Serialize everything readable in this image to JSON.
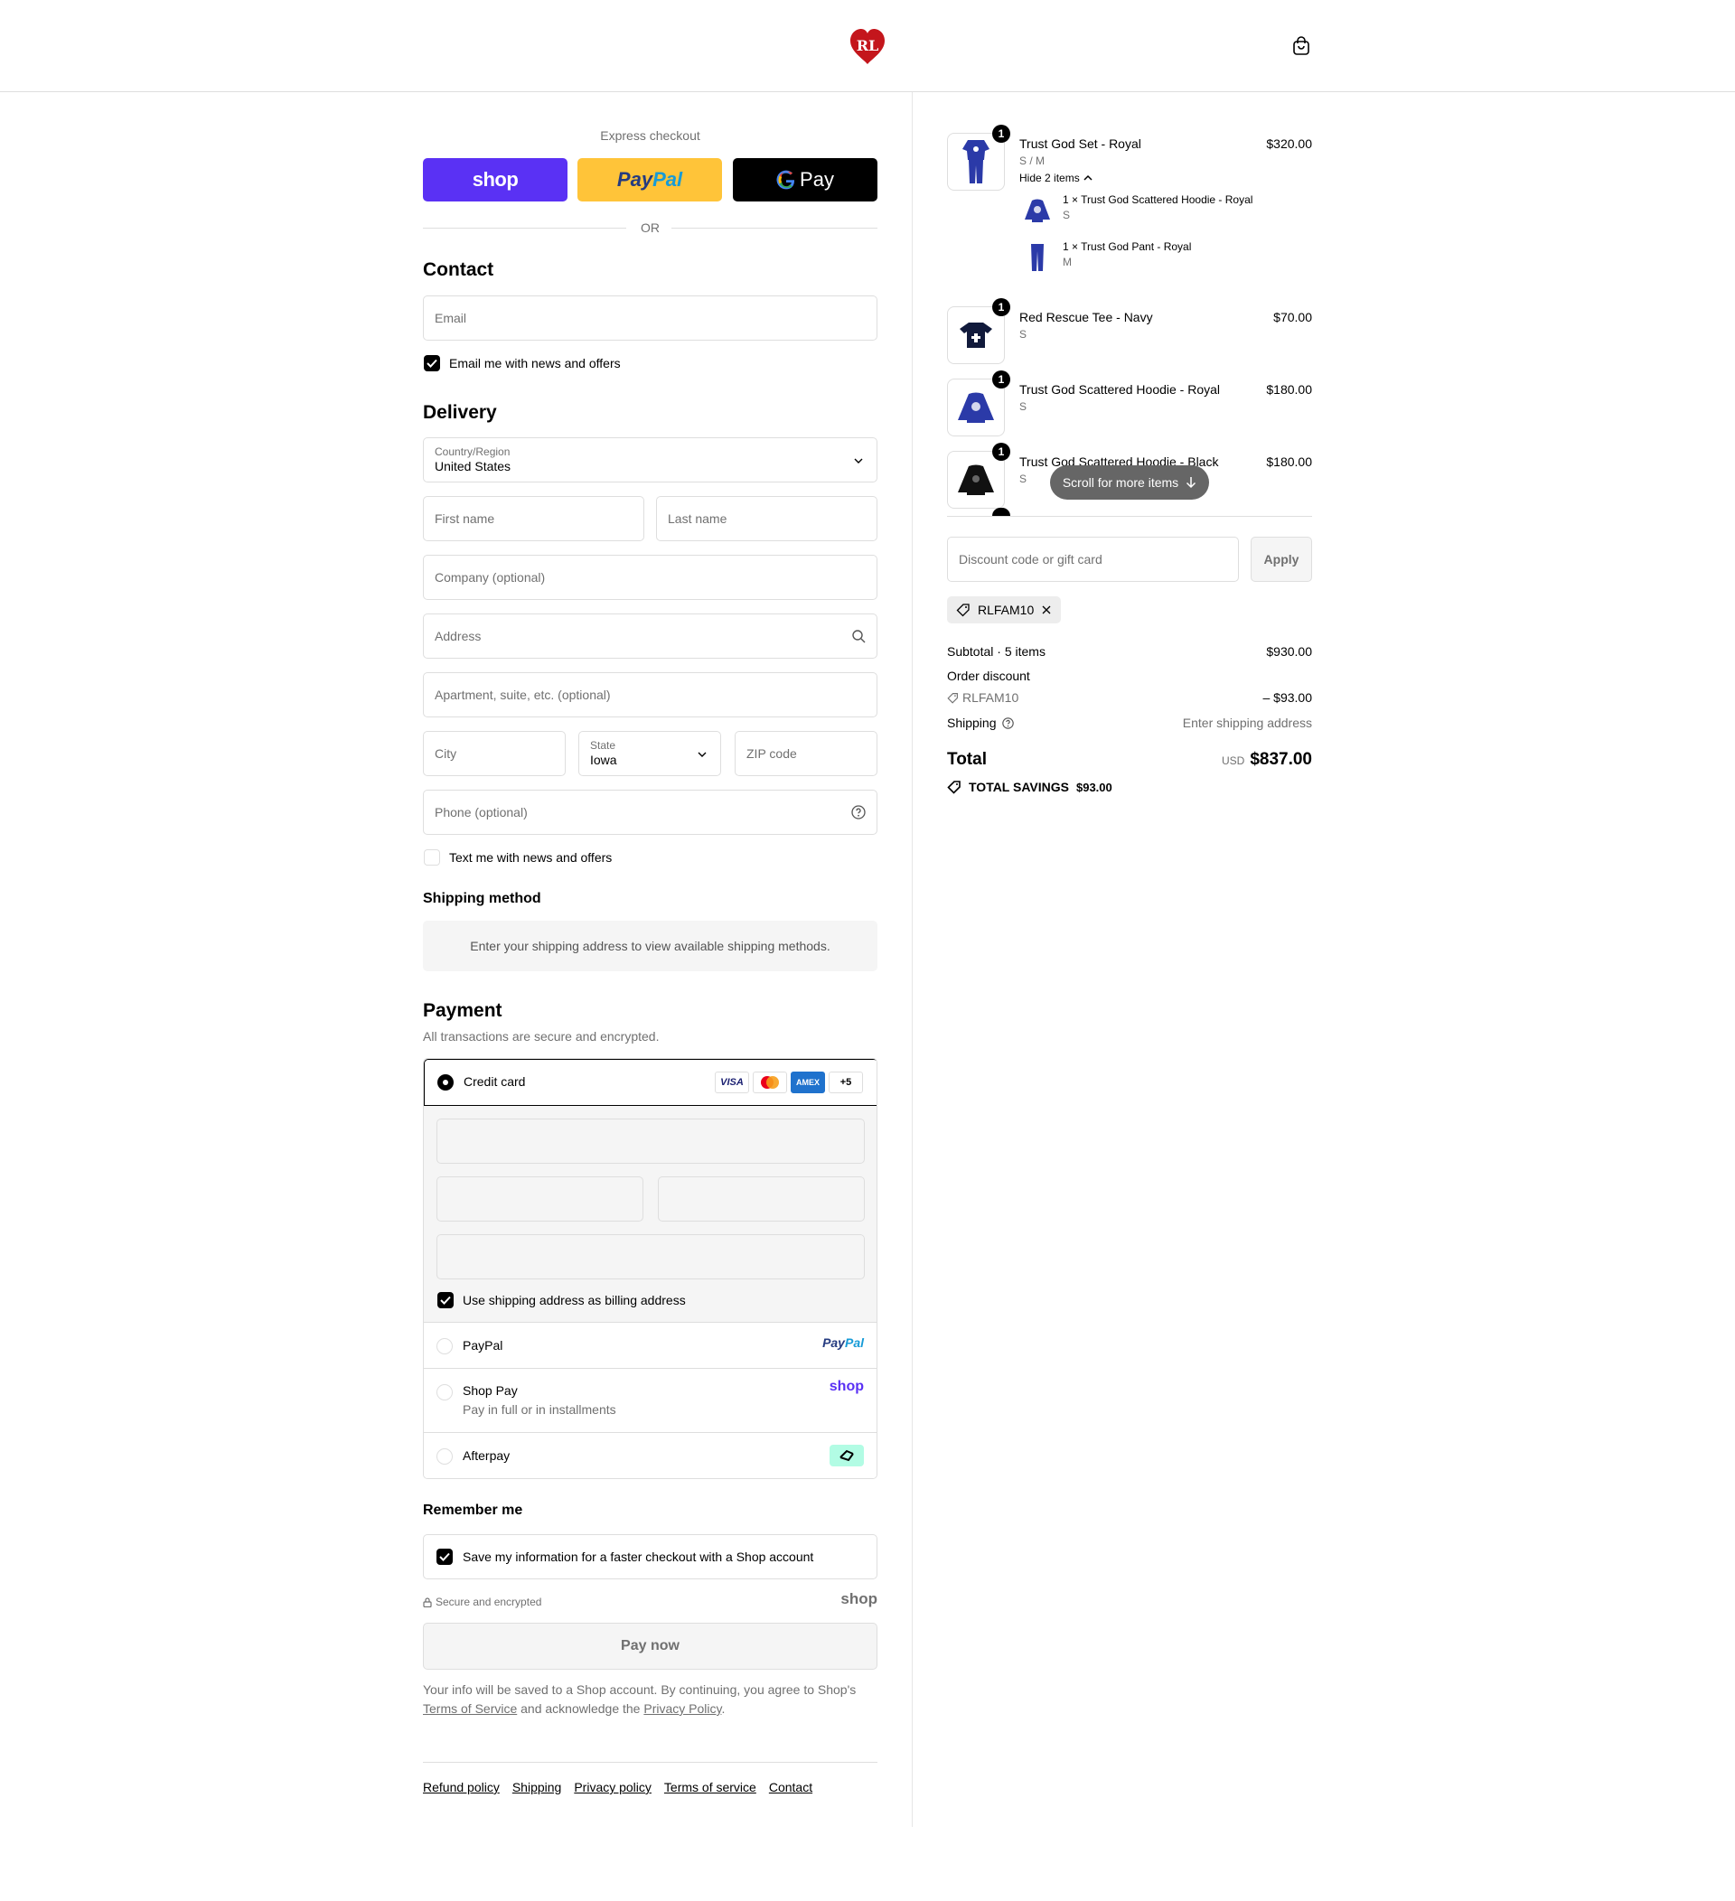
{
  "header": {
    "logo_text": "RL",
    "brand_color": "#c4161c"
  },
  "express": {
    "label": "Express checkout",
    "shop_label": "shop",
    "paypal_label_1": "Pay",
    "paypal_label_2": "Pal",
    "gpay_label": "Pay",
    "or_label": "OR"
  },
  "contact": {
    "title": "Contact",
    "email_placeholder": "Email",
    "news_label": "Email me with news and offers",
    "news_checked": true
  },
  "delivery": {
    "title": "Delivery",
    "country_label": "Country/Region",
    "country_value": "United States",
    "first_name": "First name",
    "last_name": "Last name",
    "company": "Company (optional)",
    "address": "Address",
    "apartment": "Apartment, suite, etc. (optional)",
    "city": "City",
    "state_label": "State",
    "state_value": "Iowa",
    "zip": "ZIP code",
    "phone": "Phone (optional)",
    "text_label": "Text me with news and offers",
    "text_checked": false
  },
  "shipping_method": {
    "title": "Shipping method",
    "message": "Enter your shipping address to view available shipping methods."
  },
  "payment": {
    "title": "Payment",
    "subtitle": "All transactions are secure and encrypted.",
    "credit_card_label": "Credit card",
    "card_logos": [
      "VISA",
      "Mastercard",
      "AMEX",
      "+5"
    ],
    "billing_label": "Use shipping address as billing address",
    "paypal_label": "PayPal",
    "paypal_logo_1": "Pay",
    "paypal_logo_2": "Pal",
    "shoppay_label": "Shop Pay",
    "shoppay_sub": "Pay in full or in installments",
    "shoppay_logo": "shop",
    "afterpay_label": "Afterpay"
  },
  "remember": {
    "title": "Remember me",
    "save_label": "Save my information for a faster checkout with a Shop account",
    "secure_label": "Secure and encrypted",
    "shop_logo": "shop"
  },
  "pay_now": "Pay now",
  "fine_print": {
    "part1": "Your info will be saved to a Shop account. By continuing, you agree to Shop's",
    "tos": "Terms of Service",
    "part2": "and acknowledge the",
    "privacy": "Privacy Policy",
    "end": "."
  },
  "footer_links": [
    "Refund policy",
    "Shipping",
    "Privacy policy",
    "Terms of service",
    "Contact"
  ],
  "order": {
    "items": [
      {
        "name": "Trust God Set - Royal",
        "variant": "S / M",
        "price": "$320.00",
        "qty": "1"
      },
      {
        "name": "Red Rescue Tee - Navy",
        "variant": "S",
        "price": "$70.00",
        "qty": "1"
      },
      {
        "name": "Trust God Scattered Hoodie - Royal",
        "variant": "S",
        "price": "$180.00",
        "qty": "1"
      },
      {
        "name": "Trust God Scattered Hoodie - Black",
        "variant": "S",
        "price": "$180.00",
        "qty": "1"
      }
    ],
    "hide_items": "Hide 2 items",
    "sub_items": [
      {
        "text": "1 × Trust God Scattered Hoodie - Royal",
        "variant": "S"
      },
      {
        "text": "1 × Trust God Pant - Royal",
        "variant": "M"
      }
    ],
    "scroll_pill": "Scroll for more items",
    "discount_placeholder": "Discount code or gift card",
    "apply": "Apply",
    "chip_code": "RLFAM10",
    "subtotal_label": "Subtotal · 5 items",
    "subtotal_value": "$930.00",
    "order_discount_label": "Order discount",
    "discount_code": "RLFAM10",
    "discount_value": "– $93.00",
    "shipping_label": "Shipping",
    "shipping_value": "Enter shipping address",
    "total_label": "Total",
    "currency": "USD",
    "total_value": "$837.00",
    "savings_label": "TOTAL SAVINGS",
    "savings_value": "$93.00"
  }
}
